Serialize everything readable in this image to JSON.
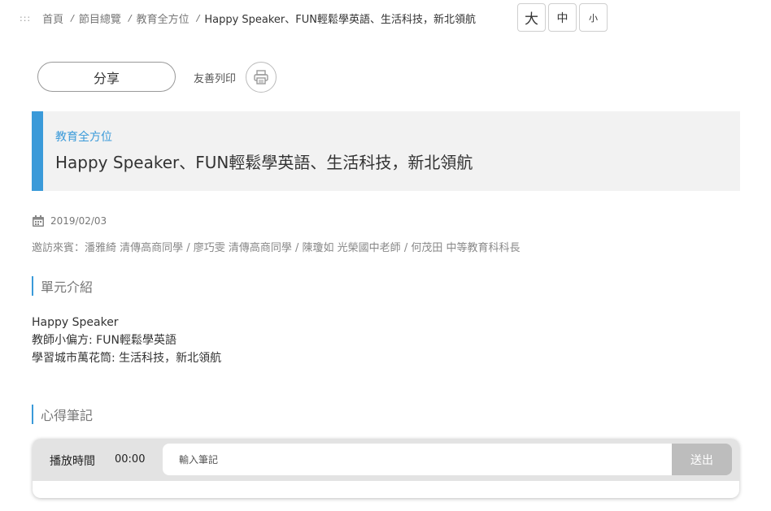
{
  "breadcrumb": {
    "dots": ":::",
    "items": [
      "首頁",
      "節目總覽",
      "教育全方位"
    ],
    "separator": "/",
    "current": "Happy Speaker、FUN輕鬆學英語、生活科技，新北領航"
  },
  "font_size": {
    "large": "大",
    "medium": "中",
    "small": "小"
  },
  "share": {
    "label": "分享"
  },
  "print": {
    "label": "友善列印",
    "icon": "printer-icon"
  },
  "article": {
    "category": "教育全方位",
    "title": "Happy Speaker、FUN輕鬆學英語、生活科技，新北領航",
    "date": "2019/02/03",
    "guests": "邀訪來賓：潘雅綺 清傳高商同學 / 廖巧雯 清傳高商同學 / 陳瓊如 光榮國中老師 / 何茂田 中等教育科科長"
  },
  "unit_intro": {
    "heading": "單元介紹",
    "lines": [
      "Happy Speaker",
      "教師小偏方: FUN輕鬆學英語",
      "學習城市萬花筒: 生活科技，新北領航"
    ]
  },
  "notes": {
    "heading": "心得筆記",
    "time_label": "播放時間",
    "time_value": "00:00",
    "input_placeholder": "輸入筆記",
    "input_value": "",
    "submit_label": "送出"
  },
  "colors": {
    "accent": "#3a9ad9",
    "title_bg": "#f2f2f2",
    "notes_bar": "#e3e3e3",
    "submit_bg": "#bdbdbd"
  }
}
